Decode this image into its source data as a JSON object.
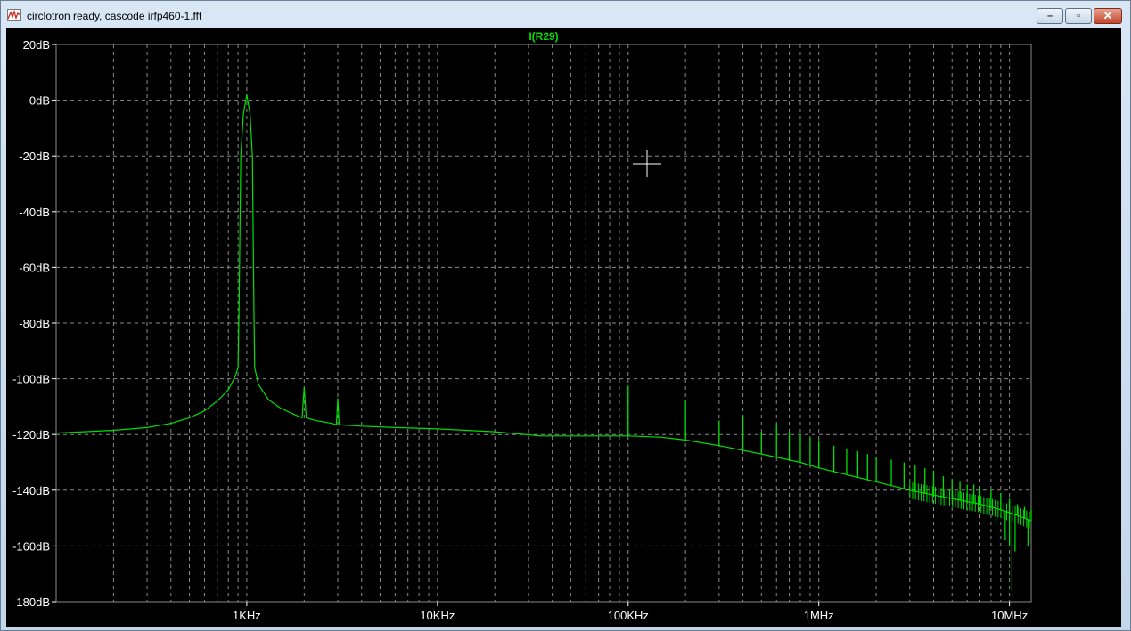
{
  "window": {
    "title": "circlotron ready, cascode irfp460-1.fft",
    "controls": {
      "minimize": "–",
      "maximize": "▫",
      "close": "✕"
    }
  },
  "colors": {
    "background": "#000000",
    "grid": "#8a8a8a",
    "trace": "#00e000",
    "axis_text": "#ffffff"
  },
  "chart_data": {
    "type": "line",
    "title": "I(R29)",
    "xlabel": "",
    "ylabel": "",
    "x_scale": "log",
    "xlim_hz": [
      100,
      13000000
    ],
    "ylim_db": [
      -180,
      20
    ],
    "grid": true,
    "y_ticks": [
      "20dB",
      "0dB",
      "-20dB",
      "-40dB",
      "-60dB",
      "-80dB",
      "-100dB",
      "-120dB",
      "-140dB",
      "-160dB",
      "-180dB"
    ],
    "y_tick_values": [
      20,
      0,
      -20,
      -40,
      -60,
      -80,
      -100,
      -120,
      -140,
      -160,
      -180
    ],
    "x_ticks": [
      "1KHz",
      "10KHz",
      "100KHz",
      "1MHz",
      "10MHz"
    ],
    "x_tick_values": [
      1000,
      10000,
      100000,
      1000000,
      10000000
    ],
    "series": [
      {
        "name": "I(R29)",
        "points_hz_db": [
          [
            100,
            -119.5
          ],
          [
            200,
            -118.5
          ],
          [
            300,
            -117.5
          ],
          [
            400,
            -116
          ],
          [
            500,
            -114
          ],
          [
            600,
            -111.5
          ],
          [
            700,
            -108
          ],
          [
            800,
            -104
          ],
          [
            870,
            -99
          ],
          [
            900,
            -96
          ],
          [
            910,
            -75
          ],
          [
            930,
            -20
          ],
          [
            960,
            -5
          ],
          [
            1000,
            2
          ],
          [
            1040,
            -5
          ],
          [
            1070,
            -20
          ],
          [
            1090,
            -75
          ],
          [
            1100,
            -96
          ],
          [
            1150,
            -102
          ],
          [
            1300,
            -107.5
          ],
          [
            1500,
            -110.5
          ],
          [
            1800,
            -113
          ],
          [
            1950,
            -114
          ],
          [
            2000,
            -103
          ],
          [
            2050,
            -114
          ],
          [
            2300,
            -115
          ],
          [
            2800,
            -116
          ],
          [
            2950,
            -116.5
          ],
          [
            3000,
            -107
          ],
          [
            3050,
            -116.5
          ],
          [
            4000,
            -117
          ],
          [
            6000,
            -117.5
          ],
          [
            10000,
            -118
          ],
          [
            20000,
            -119
          ],
          [
            35000,
            -120.5
          ],
          [
            60000,
            -120.5
          ],
          [
            100000,
            -120.5
          ],
          [
            150000,
            -121
          ],
          [
            200000,
            -122
          ],
          [
            300000,
            -124
          ],
          [
            500000,
            -127
          ],
          [
            800000,
            -130
          ],
          [
            1000000,
            -132
          ],
          [
            2000000,
            -137
          ],
          [
            3000000,
            -140
          ],
          [
            5000000,
            -143
          ],
          [
            7000000,
            -145
          ],
          [
            9000000,
            -147
          ],
          [
            11000000,
            -149
          ],
          [
            13000000,
            -151
          ]
        ],
        "harmonic_spikes_hz_db": [
          [
            100000,
            -102.5
          ],
          [
            200000,
            -108
          ],
          [
            300000,
            -115
          ],
          [
            400000,
            -113
          ],
          [
            500000,
            -119
          ],
          [
            600000,
            -116
          ],
          [
            700000,
            -119
          ],
          [
            800000,
            -120
          ],
          [
            900000,
            -121
          ],
          [
            1000000,
            -122
          ],
          [
            1200000,
            -124
          ],
          [
            1400000,
            -125
          ],
          [
            1600000,
            -126
          ],
          [
            1800000,
            -127
          ],
          [
            2000000,
            -128
          ],
          [
            2400000,
            -129
          ],
          [
            2800000,
            -130
          ],
          [
            3200000,
            -131
          ],
          [
            3600000,
            -132
          ],
          [
            4000000,
            -133
          ],
          [
            4500000,
            -135
          ],
          [
            5000000,
            -136
          ],
          [
            5500000,
            -137
          ],
          [
            6000000,
            -138
          ],
          [
            6500000,
            -138
          ],
          [
            7000000,
            -139
          ],
          [
            8000000,
            -140
          ],
          [
            9000000,
            -141
          ],
          [
            10000000,
            -143
          ],
          [
            11000000,
            -145
          ],
          [
            12000000,
            -146
          ],
          [
            13000000,
            -147
          ]
        ],
        "dips_hz_db": [
          [
            8500000,
            -152
          ],
          [
            9500000,
            -158
          ],
          [
            10000000,
            -160
          ],
          [
            10300000,
            -176
          ],
          [
            10700000,
            -162
          ],
          [
            12500000,
            -160
          ]
        ]
      }
    ]
  }
}
